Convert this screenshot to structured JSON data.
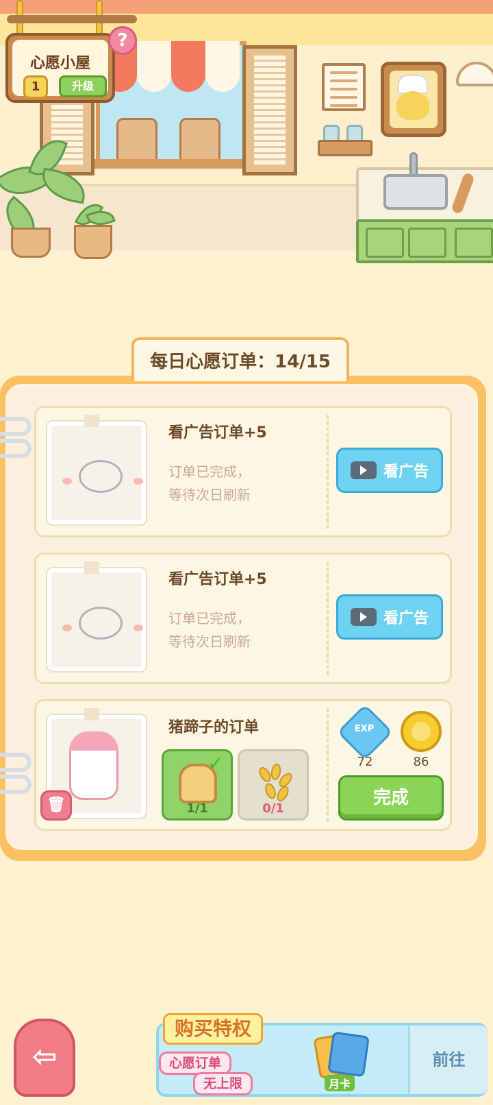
{
  "sign": {
    "title": "心愿小屋",
    "level": "1",
    "upgrade_label": "升级",
    "help_icon": "?"
  },
  "panel": {
    "title": "每日心愿订单：14/15"
  },
  "orders": [
    {
      "title": "看广告订单+5",
      "status": "订单已完成，\n等待次日刷新",
      "button_label": "看广告"
    },
    {
      "title": "看广告订单+5",
      "status": "订单已完成，\n等待次日刷新",
      "button_label": "看广告"
    },
    {
      "title": "猪蹄子的订单",
      "ingredients": [
        {
          "icon": "bread-icon",
          "count": "1/1",
          "done": true
        },
        {
          "icon": "wheat-icon",
          "count": "0/1",
          "done": false
        }
      ],
      "rewards": [
        {
          "icon": "exp-icon",
          "label": "EXP",
          "value": "72"
        },
        {
          "icon": "coin-icon",
          "value": "86"
        }
      ],
      "button_label": "完成"
    }
  ],
  "banner": {
    "headline": "购买特权",
    "line1": "心愿订单",
    "line2": "无上限",
    "card_label": "月卡",
    "go_label": "前往"
  },
  "colors": {
    "accent_orange": "#fbc061",
    "ad_button": "#6dd3f0",
    "done_button": "#8ad457",
    "back_button": "#f27d84"
  }
}
